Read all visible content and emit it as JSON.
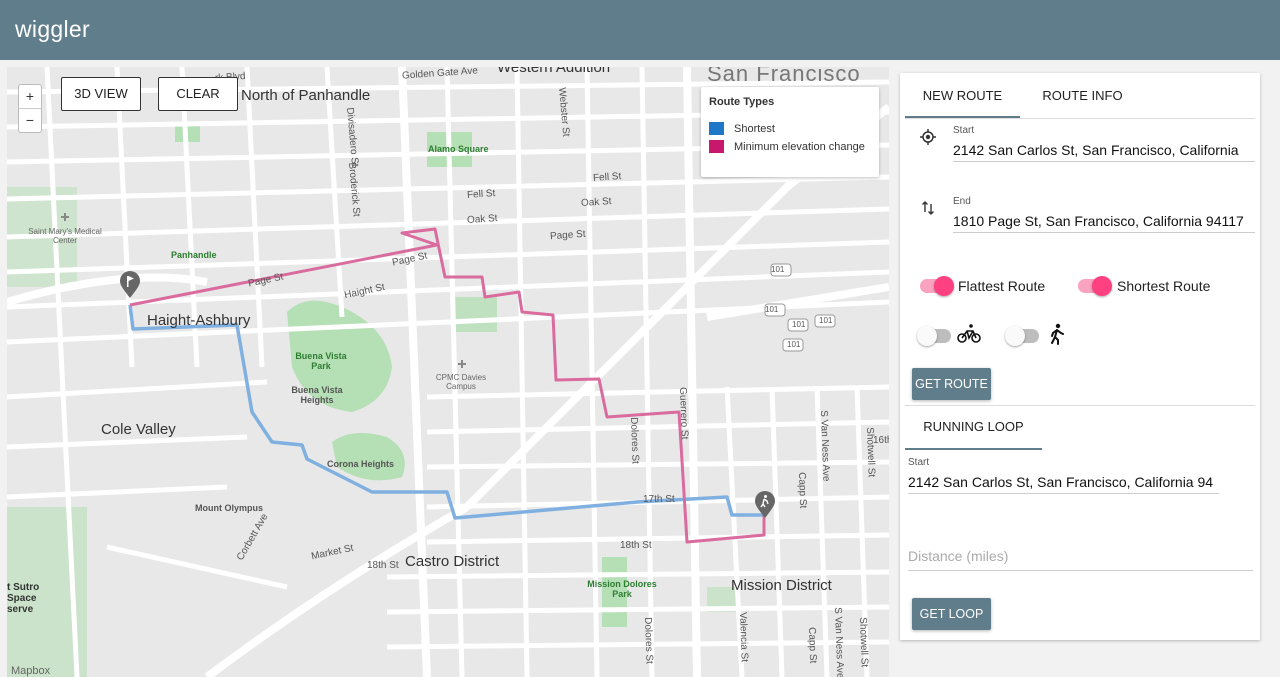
{
  "app": {
    "title": "wiggler"
  },
  "map": {
    "zoom_in": "+",
    "zoom_out": "−",
    "view_3d_label": "3D VIEW",
    "clear_label": "CLEAR",
    "legend": {
      "title": "Route Types",
      "items": [
        {
          "label": "Shortest",
          "color": "#1f77c8"
        },
        {
          "label": "Minimum elevation change",
          "color": "#c8186e"
        }
      ]
    },
    "route_colors": {
      "shortest": "#7fb0e0",
      "flattest": "#d96b9e"
    },
    "place_labels": {
      "city": "San Francisco",
      "haight": "Haight-Ashbury",
      "north_panhandle": "North of Panhandle",
      "cole_valley": "Cole Valley",
      "castro": "Castro District",
      "mission": "Mission District",
      "western_addition": "Western Addition"
    },
    "park_labels": {
      "alamo": "Alamo Square",
      "panhandle": "Panhandle",
      "buena_vista": "Buena Vista Park",
      "buena_vista_heights": "Buena Vista Heights",
      "corona": "Corona Heights",
      "mount_olympus": "Mount Olympus",
      "mission_dolores": "Mission Dolores Park",
      "cpmc": "CPMC Davies Campus",
      "st_marys": "Saint Mary's Medical Center",
      "sutro": "t Sutro Space serve"
    },
    "street_labels": {
      "golden_gate": "Golden Gate Ave",
      "fell": "Fell St",
      "oak": "Oak St",
      "page": "Page St",
      "haight": "Haight St",
      "market": "Market St",
      "st18": "18th St",
      "st17": "17th St",
      "divisadero": "Divisadero St",
      "webster": "Webster St",
      "broderick": "Broderick St",
      "dolores": "Dolores St",
      "guerrero": "Guerrero St",
      "valencia": "Valencia St",
      "van_ness": "S Van Ness Ave",
      "shotwell": "Shotwell St",
      "capp": "Capp St",
      "corbett": "Corbett Ave",
      "park_blvd": "rk Blvd",
      "st16": "16th",
      "hwy": "101"
    },
    "attribution": "Mapbox"
  },
  "panel": {
    "tabs": [
      "NEW ROUTE",
      "ROUTE INFO"
    ],
    "start_label": "Start",
    "start_value": "2142 San Carlos St, San Francisco, California",
    "end_label": "End",
    "end_value": "1810 Page St, San Francisco, California 94117",
    "toggles": {
      "flattest_label": "Flattest Route",
      "shortest_label": "Shortest Route"
    },
    "get_route_label": "GET ROUTE",
    "running_loop_tab": "RUNNING LOOP",
    "loop_start_label": "Start",
    "loop_start_value": "2142 San Carlos St, San Francisco, California 94",
    "distance_placeholder": "Distance (miles)",
    "get_loop_label": "GET LOOP"
  }
}
